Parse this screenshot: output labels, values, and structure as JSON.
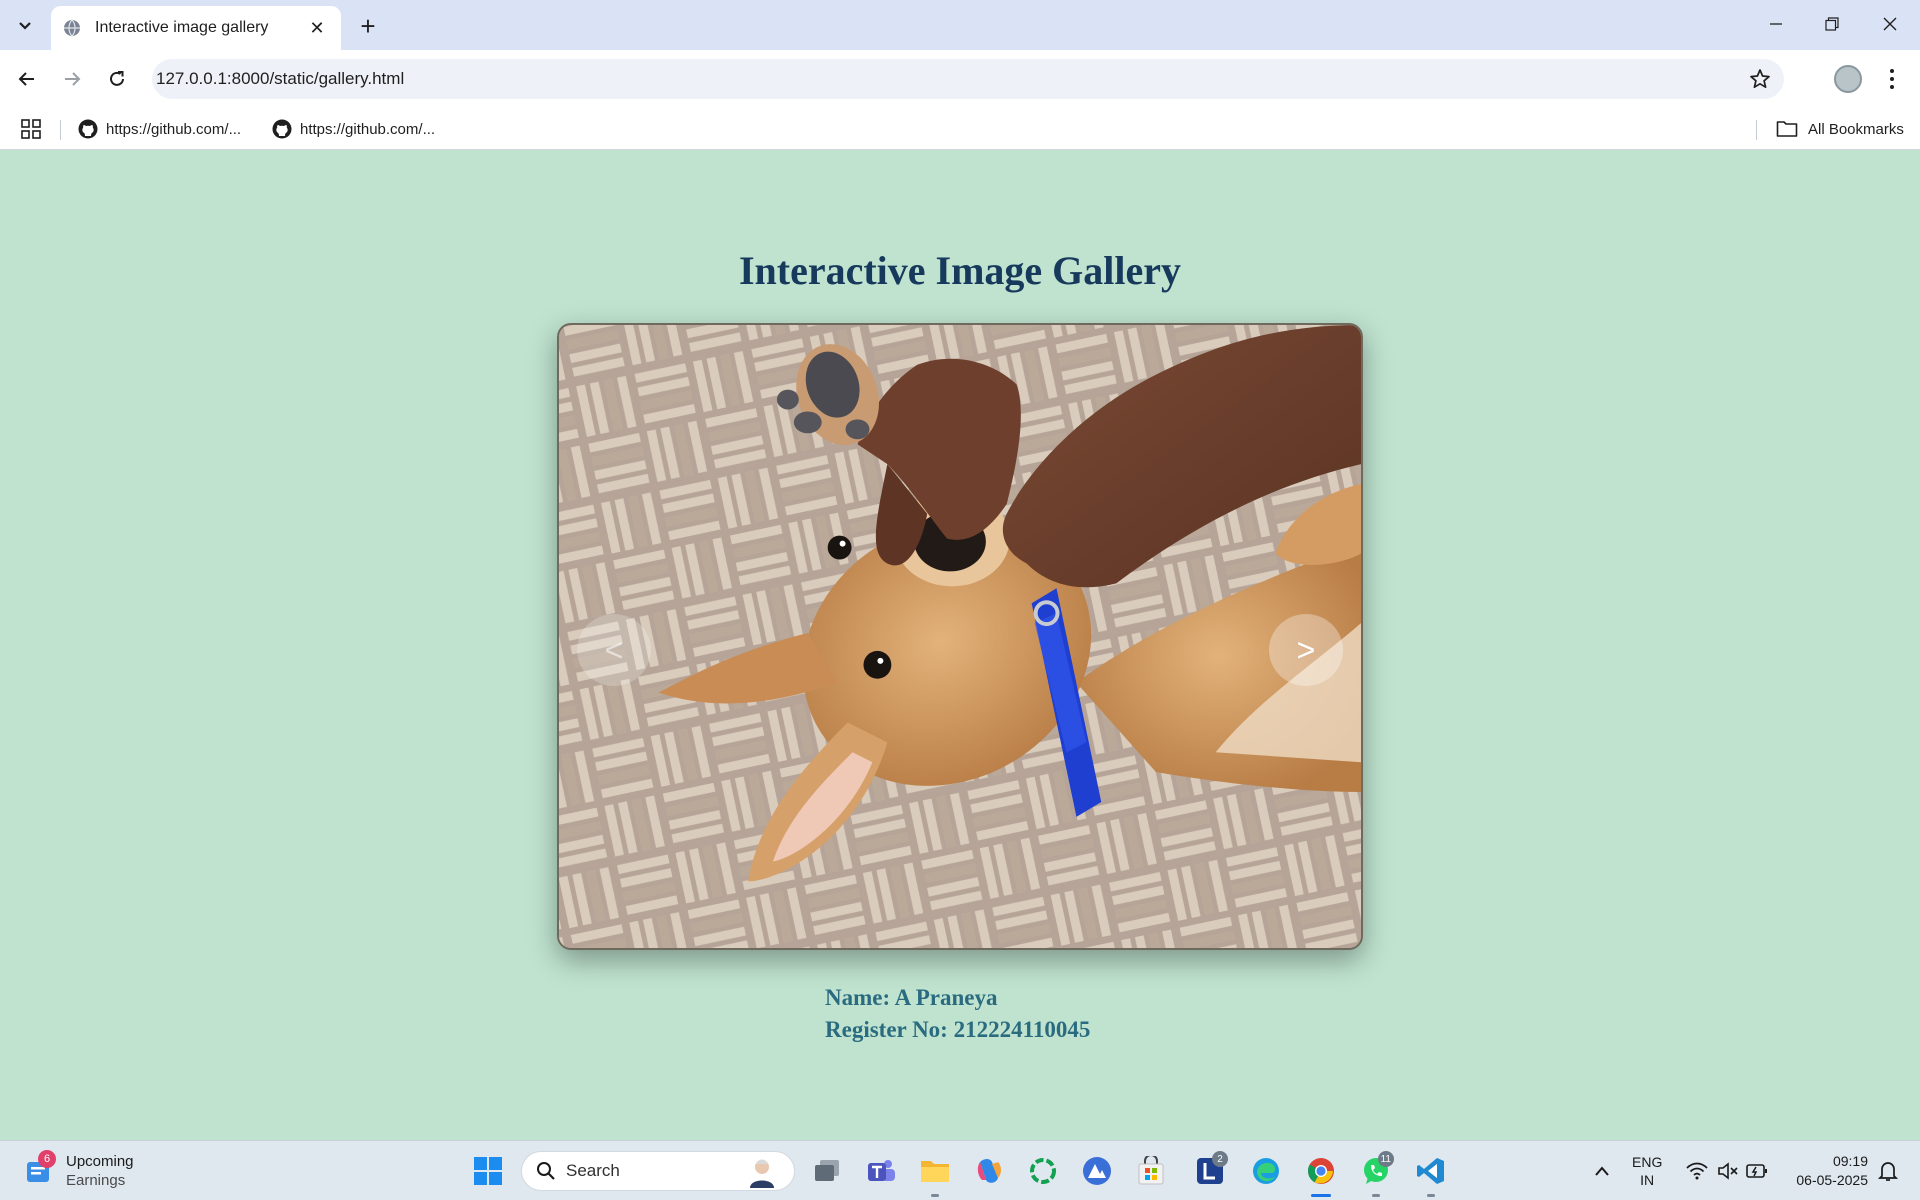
{
  "browser": {
    "tab_title": "Interactive image gallery",
    "url": "127.0.0.1:8000/static/gallery.html",
    "bookmarks": [
      {
        "label": "https://github.com/..."
      },
      {
        "label": "https://github.com/..."
      }
    ],
    "all_bookmarks_label": "All Bookmarks"
  },
  "page": {
    "title": "Interactive Image Gallery",
    "prev_label": "<",
    "next_label": ">",
    "name_line": "Name: A Praneya",
    "register_line": "Register No: 212224110045",
    "background_color": "#bfe3cf",
    "title_color": "#17395c",
    "info_color": "#2a6b80"
  },
  "taskbar": {
    "widget_badge": "6",
    "widget_title": "Upcoming",
    "widget_subtitle": "Earnings",
    "search_label": "Search",
    "lens_badge": "2",
    "whatsapp_badge": "11",
    "lang_line1": "ENG",
    "lang_line2": "IN",
    "time": "09:19",
    "date": "06-05-2025"
  }
}
